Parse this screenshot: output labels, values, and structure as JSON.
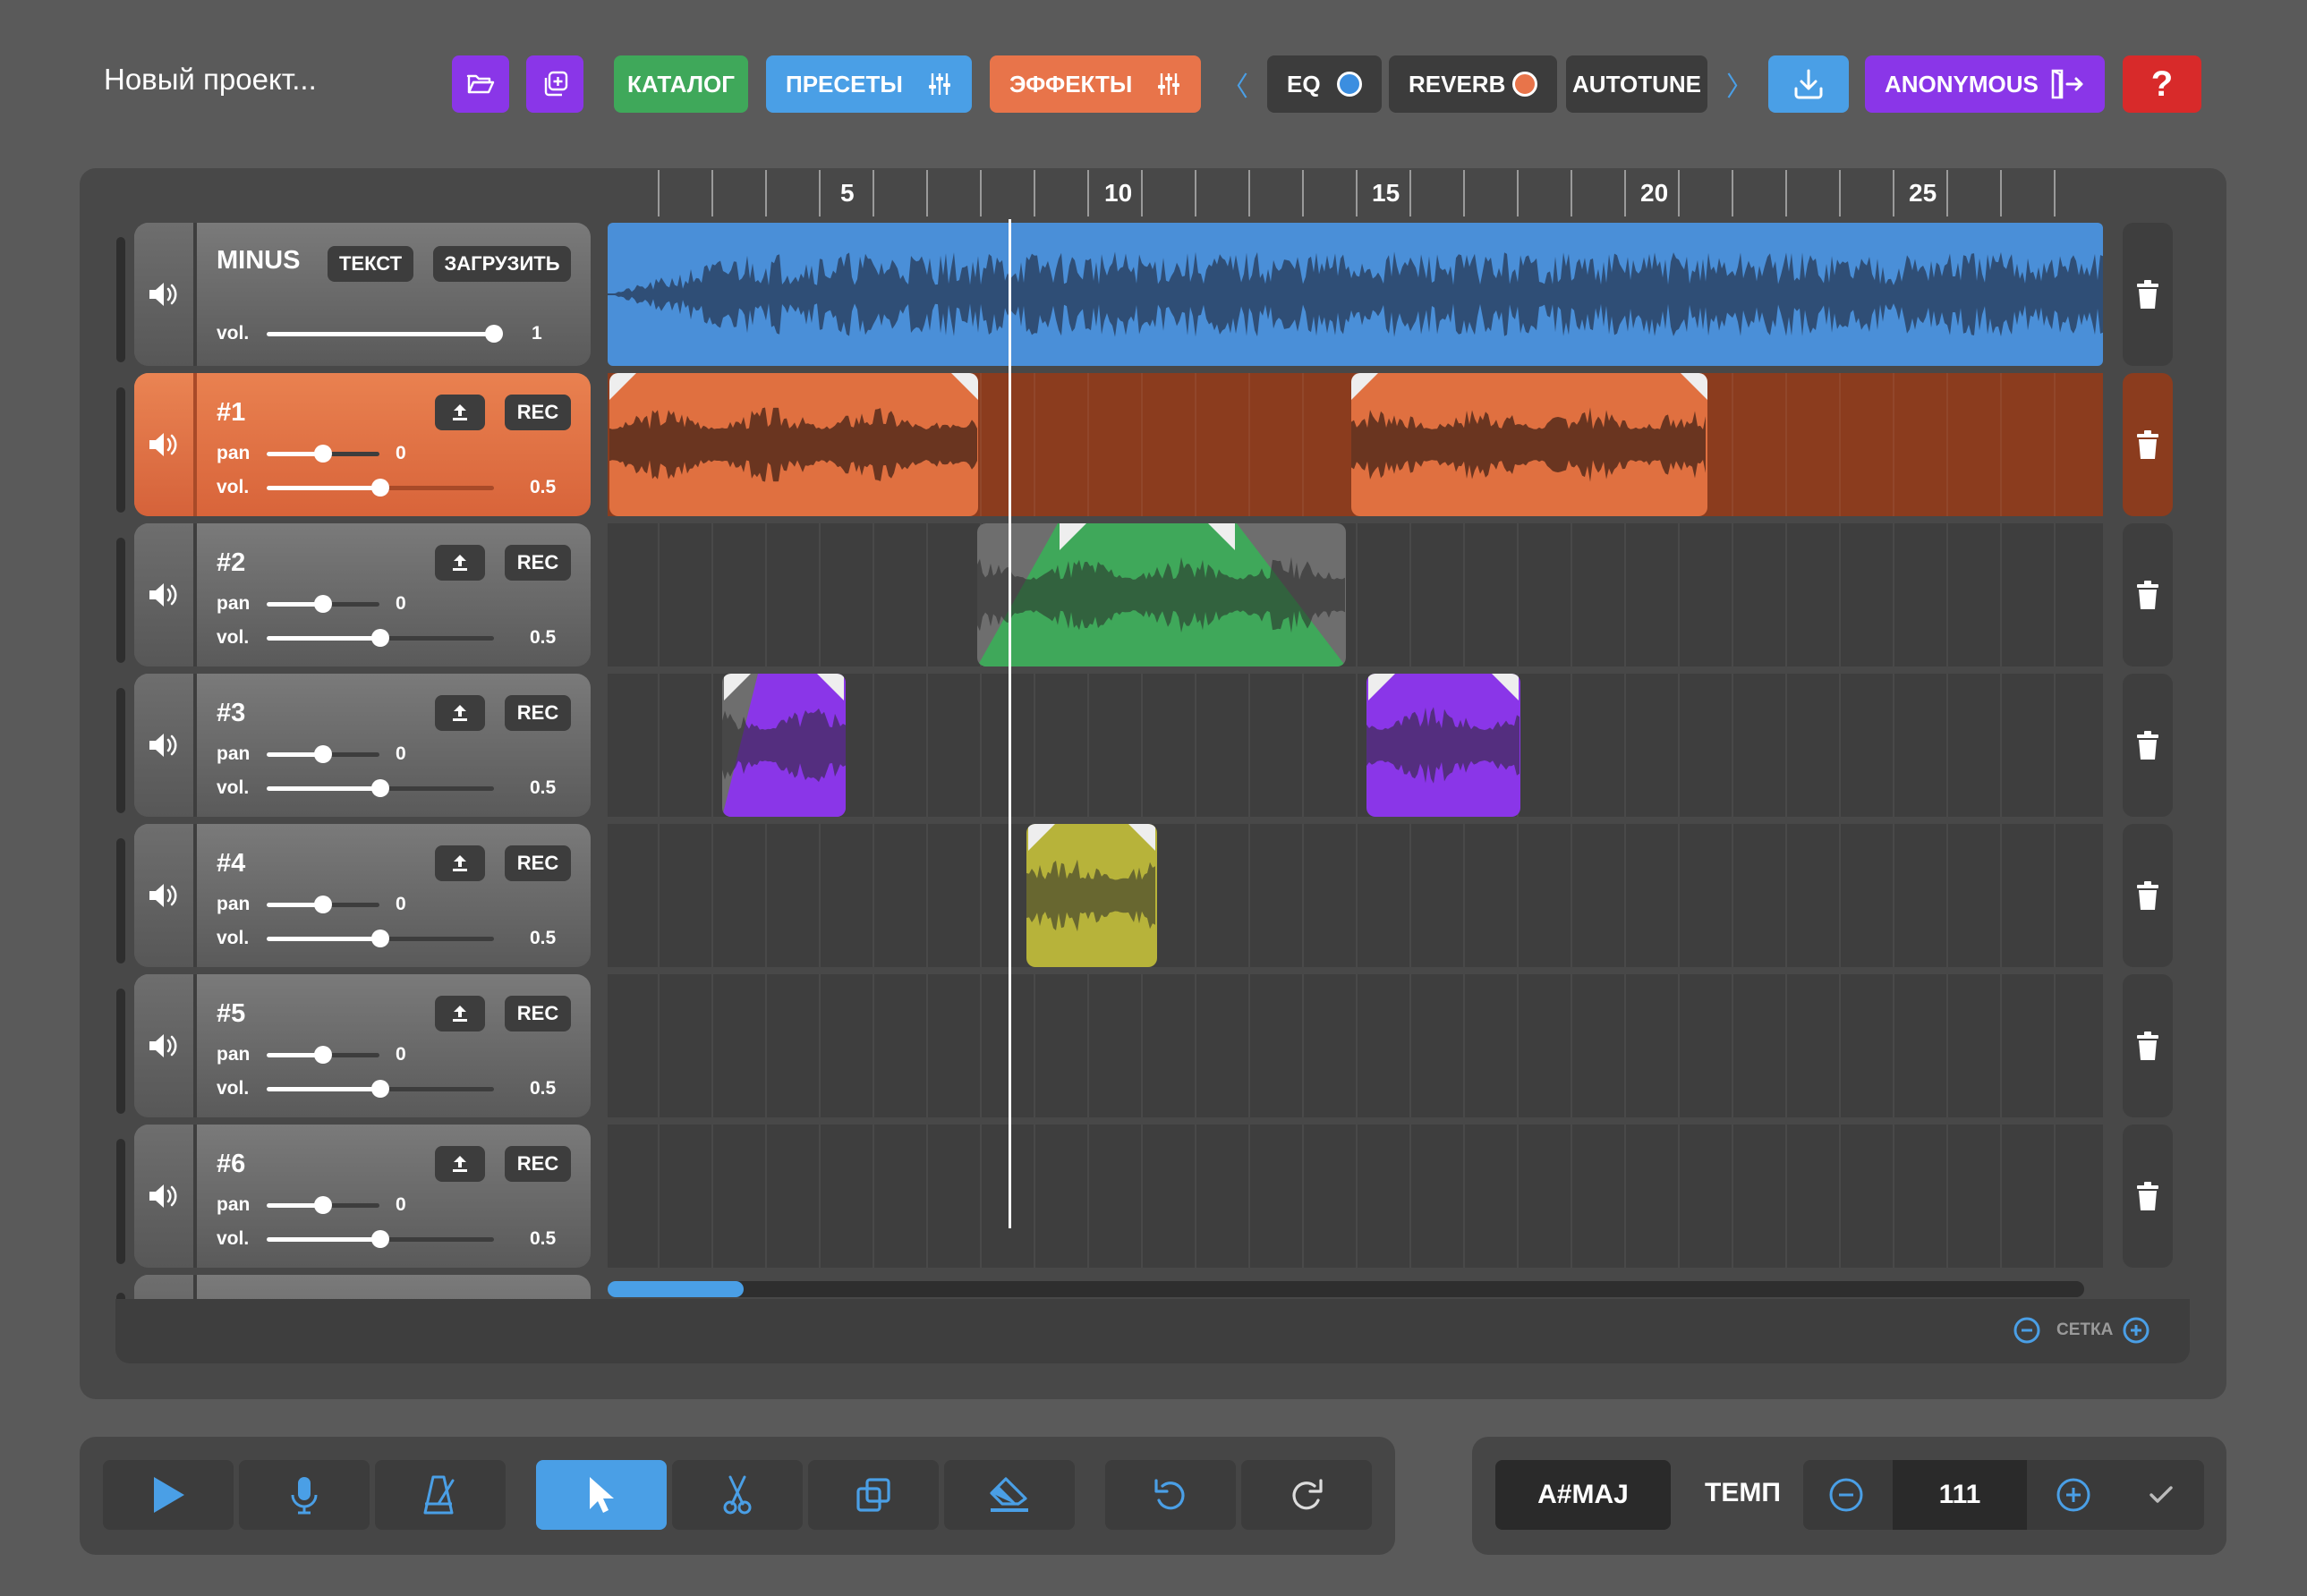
{
  "project": {
    "title": "Новый проект..."
  },
  "toolbar": {
    "open_icon": "folder-open-icon",
    "duplicate_icon": "copy-plus-icon",
    "catalog_label": "КАТАЛОГ",
    "presets_label": "ПРЕСЕТЫ",
    "effects_label": "ЭФФЕКТЫ",
    "fx_prev": "〈",
    "fx_next": "〉",
    "effects": [
      {
        "label": "EQ",
        "indicator_color": "#3b8ee0"
      },
      {
        "label": "REVERB",
        "indicator_color": "#e8744a"
      },
      {
        "label": "AUTOTUNE"
      }
    ],
    "download_icon": "download-icon",
    "user_label": "ANONYMOUS",
    "logout_icon": "logout-icon",
    "help_label": "?"
  },
  "colors": {
    "catalog": "#3fa85a",
    "presets": "#4a9fe6",
    "effects": "#e8744a",
    "download": "#4a9fe6",
    "user": "#8a36e8",
    "help": "#d82a2a",
    "minus_track": "#4a8fd8",
    "track1": "#e07040",
    "track2": "#3fa85a",
    "track3": "#8a36e8",
    "track4": "#b7b33a"
  },
  "ruler": {
    "marks": [
      "5",
      "10",
      "15",
      "20",
      "25"
    ]
  },
  "minus_track": {
    "name": "MINUS",
    "text_label": "ТЕКСТ",
    "upload_label": "ЗАГРУЗИТЬ",
    "vol_label": "vol.",
    "vol_value": "1",
    "vol_level": 1
  },
  "tracks": [
    {
      "name": "#1",
      "pan_label": "pan",
      "pan_value": "0",
      "vol_label": "vol.",
      "vol_value": "0.5",
      "rec_label": "REC",
      "active": true
    },
    {
      "name": "#2",
      "pan_label": "pan",
      "pan_value": "0",
      "vol_label": "vol.",
      "vol_value": "0.5",
      "rec_label": "REC"
    },
    {
      "name": "#3",
      "pan_label": "pan",
      "pan_value": "0",
      "vol_label": "vol.",
      "vol_value": "0.5",
      "rec_label": "REC"
    },
    {
      "name": "#4",
      "pan_label": "pan",
      "pan_value": "0",
      "vol_label": "vol.",
      "vol_value": "0.5",
      "rec_label": "REC"
    },
    {
      "name": "#5",
      "pan_label": "pan",
      "pan_value": "0",
      "vol_label": "vol.",
      "vol_value": "0.5",
      "rec_label": "REC"
    },
    {
      "name": "#6",
      "pan_label": "pan",
      "pan_value": "0",
      "vol_label": "vol.",
      "vol_value": "0.5",
      "rec_label": "REC"
    }
  ],
  "grid": {
    "label": "СЕТКА"
  },
  "transport": {
    "play_icon": "play-icon",
    "mic_icon": "microphone-icon",
    "metronome_icon": "metronome-icon",
    "select_icon": "cursor-arrow-icon",
    "cut_icon": "scissors-icon",
    "copy_icon": "copy-icon",
    "erase_icon": "eraser-icon",
    "undo_icon": "undo-icon",
    "redo_icon": "redo-icon"
  },
  "tempo": {
    "key": "A#MAJ",
    "label": "ТЕМП",
    "value": "111"
  }
}
